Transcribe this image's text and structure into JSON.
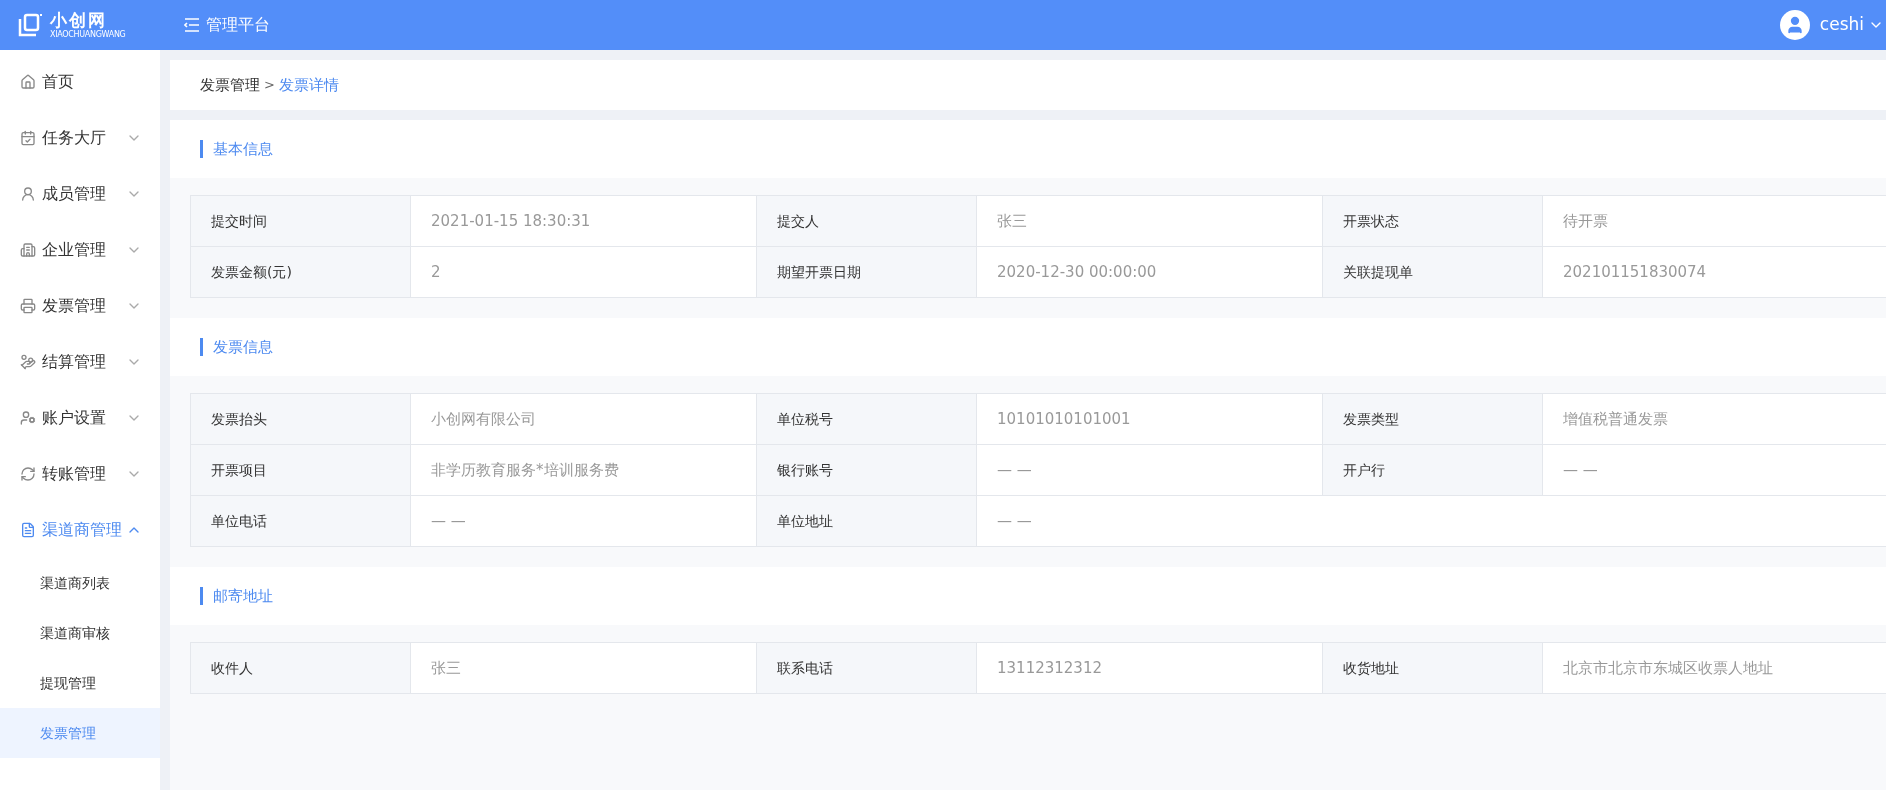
{
  "header": {
    "logo": {
      "name": "小创网",
      "subtitle": "XIAOCHUANGWANG"
    },
    "title": "管理平台",
    "user": "ceshi"
  },
  "sidebar": {
    "items": [
      {
        "label": "首页",
        "selected": false
      },
      {
        "label": "任务大厅",
        "selected": false,
        "expanded": false
      },
      {
        "label": "成员管理",
        "selected": false,
        "expanded": false
      },
      {
        "label": "企业管理",
        "selected": false,
        "expanded": false
      },
      {
        "label": "发票管理",
        "selected": false,
        "expanded": false
      },
      {
        "label": "结算管理",
        "selected": false,
        "expanded": false
      },
      {
        "label": "账户设置",
        "selected": false,
        "expanded": false
      },
      {
        "label": "转账管理",
        "selected": false,
        "expanded": false
      },
      {
        "label": "渠道商管理",
        "selected": true,
        "expanded": true,
        "children": [
          {
            "label": "渠道商列表",
            "selected": false
          },
          {
            "label": "渠道商审核",
            "selected": false
          },
          {
            "label": "提现管理",
            "selected": false
          },
          {
            "label": "发票管理",
            "selected": true
          }
        ]
      }
    ]
  },
  "breadcrumb": [
    {
      "label": "发票管理",
      "selected": false
    },
    {
      "label": ">",
      "kind": "separator"
    },
    {
      "label": "发票详情",
      "selected": true
    }
  ],
  "sections": [
    {
      "title": "基本信息",
      "rows": [
        [
          {
            "label": "提交时间",
            "value": "2021-01-15 18:30:31"
          },
          {
            "label": "提交人",
            "value": "张三"
          },
          {
            "label": "开票状态",
            "value": "待开票"
          }
        ],
        [
          {
            "label": "发票金额(元)",
            "value": "2"
          },
          {
            "label": "期望开票日期",
            "value": "2020-12-30 00:00:00"
          },
          {
            "label": "关联提现单",
            "value": "202101151830074"
          }
        ]
      ]
    },
    {
      "title": "发票信息",
      "rows": [
        [
          {
            "label": "发票抬头",
            "value": "小创网有限公司"
          },
          {
            "label": "单位税号",
            "value": "10101010101001"
          },
          {
            "label": "发票类型",
            "value": "增值税普通发票"
          }
        ],
        [
          {
            "label": "开票项目",
            "value": "非学历教育服务*培训服务费"
          },
          {
            "label": "银行账号",
            "value": "— —"
          },
          {
            "label": "开户行",
            "value": "— —"
          }
        ],
        [
          {
            "label": "单位电话",
            "value": "— —"
          },
          {
            "label": "单位地址",
            "value": "— —"
          }
        ]
      ]
    },
    {
      "title": "邮寄地址",
      "rows": [
        [
          {
            "label": "收件人",
            "value": "张三"
          },
          {
            "label": "联系电话",
            "value": "13112312312"
          },
          {
            "label": "收货地址",
            "value": "北京市北京市东城区收票人地址"
          }
        ]
      ]
    }
  ]
}
